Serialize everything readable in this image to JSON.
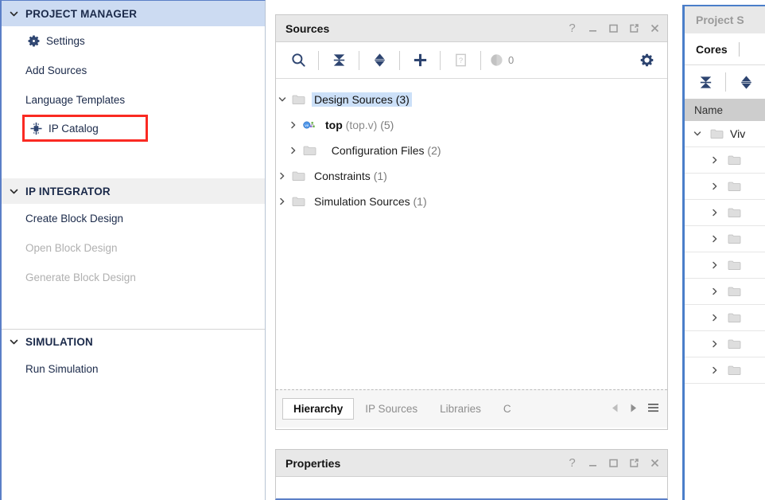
{
  "flow_navigator": {
    "sections": [
      {
        "id": "project-manager",
        "label": "PROJECT MANAGER",
        "style": "accent",
        "items": [
          {
            "label": "Settings",
            "icon": "gear-icon",
            "state": "enabled",
            "highlighted": false
          },
          {
            "label": "Add Sources",
            "icon": "none",
            "state": "enabled",
            "highlighted": false
          },
          {
            "label": "Language Templates",
            "icon": "none",
            "state": "enabled",
            "highlighted": false
          },
          {
            "label": "IP Catalog",
            "icon": "ip-chip-icon",
            "state": "enabled",
            "highlighted": true
          }
        ]
      },
      {
        "id": "ip-integrator",
        "label": "IP INTEGRATOR",
        "style": "gray",
        "items": [
          {
            "label": "Create Block Design",
            "icon": "none",
            "state": "enabled",
            "highlighted": false
          },
          {
            "label": "Open Block Design",
            "icon": "none",
            "state": "disabled",
            "highlighted": false
          },
          {
            "label": "Generate Block Design",
            "icon": "none",
            "state": "disabled",
            "highlighted": false
          }
        ]
      },
      {
        "id": "simulation",
        "label": "SIMULATION",
        "style": "plain",
        "items": [
          {
            "label": "Run Simulation",
            "icon": "none",
            "state": "enabled",
            "highlighted": false
          }
        ]
      }
    ],
    "highlight_color": "#fa2a22",
    "header_accent_color": "#ccdbf2"
  },
  "sources_panel": {
    "title": "Sources",
    "window_buttons": [
      "help-icon",
      "minimize-icon",
      "maximize-icon",
      "float-icon",
      "close-icon"
    ],
    "toolbar": {
      "buttons": [
        "search-icon",
        "collapse-all-icon",
        "expand-all-icon",
        "add-sources-icon",
        "report-icon"
      ],
      "count_label": "0",
      "settings_icon": "gear-icon"
    },
    "tree": [
      {
        "label": "Design Sources",
        "count": "(3)",
        "selected": true,
        "expanded": true,
        "indent": 0,
        "icon": "folder-icon"
      },
      {
        "label": "top",
        "sub": "(top.v)",
        "count": "(5)",
        "selected": false,
        "expanded": false,
        "indent": 1,
        "icon": "verilog-module-icon",
        "bold": true
      },
      {
        "label": "Configuration Files",
        "count": "(2)",
        "selected": false,
        "expanded": false,
        "indent": 1,
        "icon": "folder-icon"
      },
      {
        "label": "Constraints",
        "count": "(1)",
        "selected": false,
        "expanded": false,
        "indent": 0,
        "icon": "folder-icon"
      },
      {
        "label": "Simulation Sources",
        "count": "(1)",
        "selected": false,
        "expanded": false,
        "indent": 0,
        "icon": "folder-icon"
      }
    ],
    "tabs": [
      {
        "label": "Hierarchy",
        "active": true
      },
      {
        "label": "IP Sources",
        "active": false
      },
      {
        "label": "Libraries",
        "active": false
      },
      {
        "label": "C",
        "active": false,
        "truncated": true
      }
    ],
    "tab_scroll": {
      "prev_icon": "triangle-left-icon",
      "next_icon": "triangle-right-icon",
      "menu_icon": "hamburger-icon"
    }
  },
  "properties_panel": {
    "title": "Properties",
    "window_buttons": [
      "help-icon",
      "minimize-icon",
      "maximize-icon",
      "float-icon",
      "close-icon"
    ]
  },
  "right_panel": {
    "title": "Project S",
    "tabs": [
      {
        "label": "Cores",
        "active": true
      }
    ],
    "toolbar": {
      "buttons": [
        "collapse-all-icon",
        "expand-all-icon"
      ]
    },
    "column_headers": [
      "Name"
    ],
    "rows": [
      {
        "label": "Viv",
        "expanded": true,
        "indent": 0
      },
      {
        "label": "",
        "expanded": false,
        "indent": 1
      },
      {
        "label": "",
        "expanded": false,
        "indent": 1
      },
      {
        "label": "",
        "expanded": false,
        "indent": 1
      },
      {
        "label": "",
        "expanded": false,
        "indent": 1
      },
      {
        "label": "",
        "expanded": false,
        "indent": 1
      },
      {
        "label": "",
        "expanded": false,
        "indent": 1
      },
      {
        "label": "",
        "expanded": false,
        "indent": 1
      },
      {
        "label": "",
        "expanded": false,
        "indent": 1
      },
      {
        "label": "",
        "expanded": false,
        "indent": 1
      }
    ],
    "border_color": "#4a7ec9"
  }
}
